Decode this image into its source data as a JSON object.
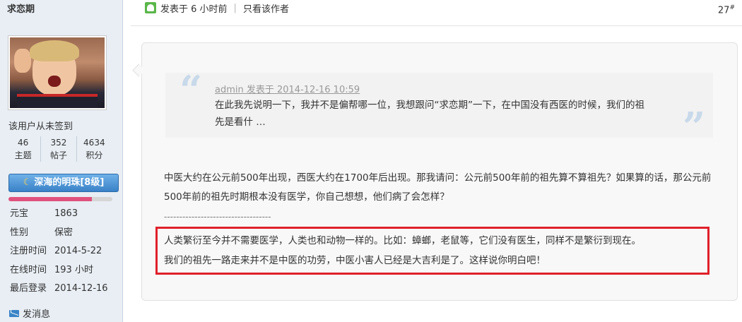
{
  "user": {
    "name": "求恋期",
    "signin_status": "该用户从未签到",
    "stats": [
      {
        "value": "46",
        "label": "主题"
      },
      {
        "value": "352",
        "label": "帖子"
      },
      {
        "value": "4634",
        "label": "积分"
      }
    ],
    "rank": "深海的明珠[8级]",
    "exp_progress": 0.8,
    "info": [
      {
        "label": "元宝",
        "value": "1863"
      },
      {
        "label": "性别",
        "value": "保密"
      },
      {
        "label": "注册时间",
        "value": "2014-5-22"
      },
      {
        "label": "在线时间",
        "value": "193 小时"
      },
      {
        "label": "最后登录",
        "value": "2014-12-16"
      }
    ],
    "send_message": "发消息"
  },
  "post": {
    "posted": "发表于 6 小时前",
    "author_only": "只看该作者",
    "floor_num": "27",
    "floor_suffix": "#",
    "quote_meta": "admin 发表于 2014-12-16 10:59",
    "quote_text": "在此我先说明一下，我并不是偏帮哪一位，我想跟问“求恋期”一下，在中国没有西医的时候，我们的祖先是看什 …",
    "body": "中医大约在公元前500年出现，西医大约在1700年后出现。那我请问：公元前500年前的祖先算不算祖先？如果算的话，那公元前500年前的祖先时期根本没有医学，你自己想想，他们病了会怎样？",
    "dashes": "-----------------------------------",
    "highlight_line1": "人类繁衍至今并不需要医学，人类也和动物一样的。比如：蟑螂，老鼠等，它们没有医生，同样不是繁衍到现在。",
    "highlight_line2": "我们的祖先一路走来并不是中医的功劳，中医小害人已经是大吉利是了。这样说你明白吧！"
  },
  "colors": {
    "highlight_border": "#e0202a",
    "rank_button": "#3a82c8",
    "exp_bar": "#e0527e"
  }
}
